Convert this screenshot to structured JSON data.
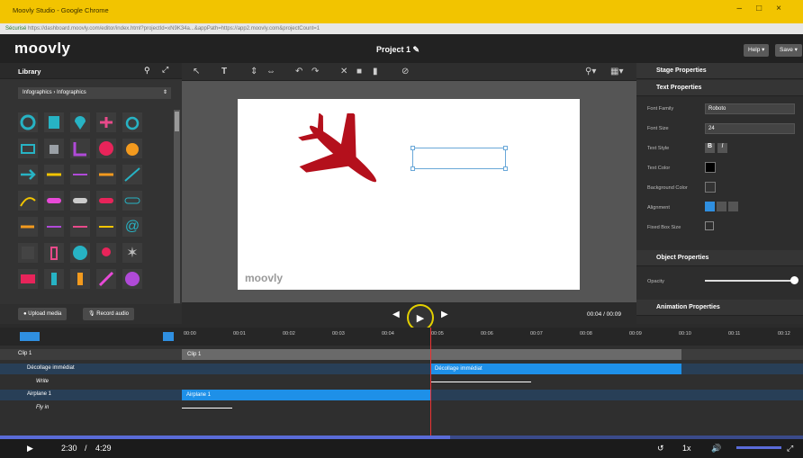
{
  "window": {
    "title": "Moovly Studio - Google Chrome",
    "url_secure": "Sécurisé",
    "url": "https://dashboard.moovly.com/editor/index.html?projectId=xN9K34a...&appPath=https://app2.moovly.com&projectCount=1"
  },
  "header": {
    "logo": "moovly",
    "project": "Project 1",
    "help": "Help ▾",
    "save": "Save ▾"
  },
  "library": {
    "title": "Library",
    "breadcrumb": "Infographics  ›  Infographics",
    "upload": "Upload media",
    "record": "Record audio"
  },
  "playback": {
    "time": "00:04 / 00:09"
  },
  "canvas": {
    "watermark": "moovly"
  },
  "props": {
    "stage": "Stage Properties",
    "text": "Text Properties",
    "font_family_label": "Font Family",
    "font_family": "Roboto",
    "font_size_label": "Font Size",
    "font_size": "24",
    "text_style_label": "Text Style",
    "text_color_label": "Text Color",
    "bg_color_label": "Background Color",
    "alignment_label": "Alignment",
    "fixed_box_label": "Fixed Box Size",
    "object": "Object Properties",
    "opacity_label": "Opacity",
    "animation": "Animation Properties"
  },
  "timeline": {
    "ticks": [
      "00:00",
      "00:01",
      "00:02",
      "00:03",
      "00:04",
      "00:05",
      "00:06",
      "00:07",
      "00:08",
      "00:09",
      "00:10",
      "00:11",
      "00:12"
    ],
    "rows": [
      {
        "label": "Clip 1",
        "bar": "Clip 1"
      },
      {
        "label": "Décollage immédiat",
        "bar": "Décollage immédiat"
      },
      {
        "label": "Write"
      },
      {
        "label": "Airplane 1",
        "bar": "Airplane 1"
      },
      {
        "label": "Fly in"
      }
    ]
  },
  "video": {
    "current": "2:30",
    "total": "4:29",
    "speed": "1x",
    "progress": 0.56
  }
}
